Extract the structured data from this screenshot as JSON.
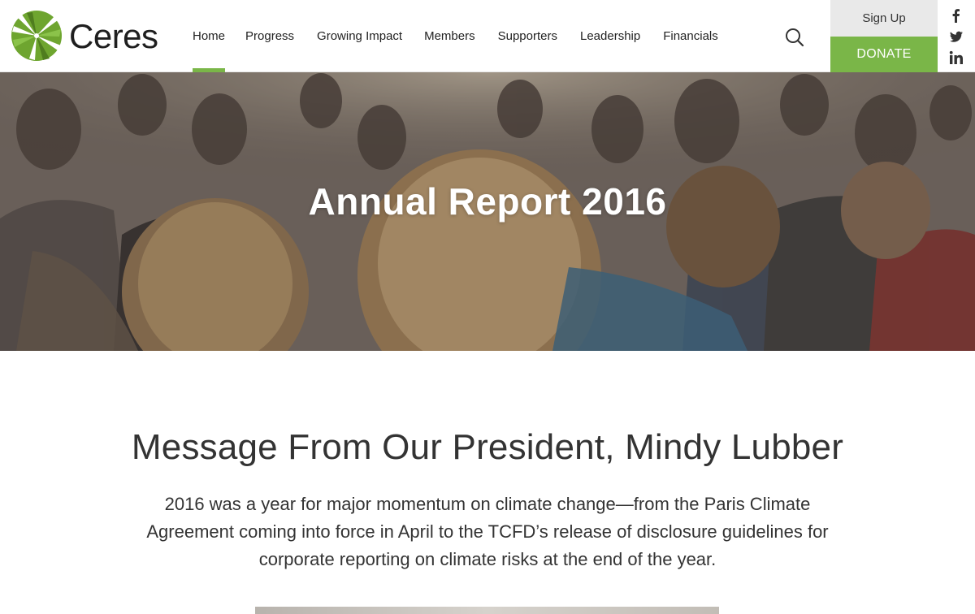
{
  "brand": {
    "name": "Ceres",
    "color": "#7ab648"
  },
  "nav": {
    "items": [
      {
        "label": "Home",
        "active": true
      },
      {
        "label": "Progress",
        "active": false
      },
      {
        "label": "Growing Impact",
        "active": false
      },
      {
        "label": "Members",
        "active": false
      },
      {
        "label": "Supporters",
        "active": false
      },
      {
        "label": "Leadership",
        "active": false
      },
      {
        "label": "Financials",
        "active": false
      }
    ],
    "search_icon": "search-icon"
  },
  "actions": {
    "signup_label": "Sign Up",
    "donate_label": "DONATE"
  },
  "social": [
    "facebook-icon",
    "twitter-icon",
    "linkedin-icon"
  ],
  "hero": {
    "title": "Annual Report 2016"
  },
  "message": {
    "title": "Message From Our President, Mindy Lubber",
    "body": "2016 was a year for major momentum on climate change—from the Paris Climate Agreement coming into force in April to the TCFD’s release of disclosure guidelines for corporate reporting on climate risks at the end of the year."
  }
}
